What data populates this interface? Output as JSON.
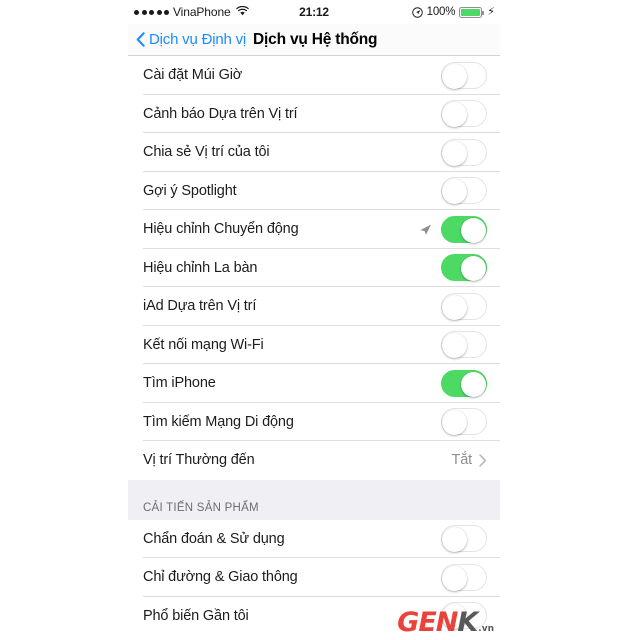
{
  "status_bar": {
    "signal_dots": 5,
    "carrier": "VinaPhone",
    "wifi_icon": "wifi-icon",
    "time": "21:12",
    "location_icon": "location-services-icon",
    "battery_percent": "100%",
    "battery_level": 100,
    "charging_icon": "lightning-bolt-icon",
    "battery_color": "#4cd964"
  },
  "nav_bar": {
    "back_icon": "chevron-left-icon",
    "back_label": "Dịch vụ Định vị",
    "title": "Dịch vụ Hệ thống",
    "accent_color": "#1a8cff"
  },
  "sections": [
    {
      "header": "",
      "rows": [
        {
          "label": "Cài đặt Múi Giờ",
          "control": "switch",
          "state": "off"
        },
        {
          "label": "Cảnh báo Dựa trên Vị trí",
          "control": "switch",
          "state": "off"
        },
        {
          "label": "Chia sẻ Vị trí của tôi",
          "control": "switch",
          "state": "off"
        },
        {
          "label": "Gợi ý Spotlight",
          "control": "switch",
          "state": "off"
        },
        {
          "label": "Hiệu chỉnh Chuyển động",
          "control": "switch",
          "state": "on",
          "icon": "location-arrow-icon"
        },
        {
          "label": "Hiệu chỉnh La bàn",
          "control": "switch",
          "state": "on"
        },
        {
          "label": "iAd Dựa trên Vị trí",
          "control": "switch",
          "state": "off"
        },
        {
          "label": "Kết nối mạng Wi-Fi",
          "control": "switch",
          "state": "off"
        },
        {
          "label": "Tìm iPhone",
          "control": "switch",
          "state": "on"
        },
        {
          "label": "Tìm kiếm Mạng Di động",
          "control": "switch",
          "state": "off"
        },
        {
          "label": "Vị trí Thường đến",
          "control": "disclosure",
          "value": "Tắt",
          "icon": "chevron-right-icon"
        }
      ]
    },
    {
      "header": "CẢI TIẾN SẢN PHẨM",
      "rows": [
        {
          "label": "Chẩn đoán & Sử dụng",
          "control": "switch",
          "state": "off"
        },
        {
          "label": "Chỉ đường & Giao thông",
          "control": "switch",
          "state": "off"
        },
        {
          "label": "Phổ biến Gần tôi",
          "control": "switch",
          "state": "off"
        }
      ]
    }
  ],
  "watermark": {
    "part1": "GEN",
    "part2": "K",
    "suffix": ".vn",
    "color1": "#e8342c",
    "color2": "#4b4b4b"
  },
  "toggle_on_color": "#4cd964"
}
